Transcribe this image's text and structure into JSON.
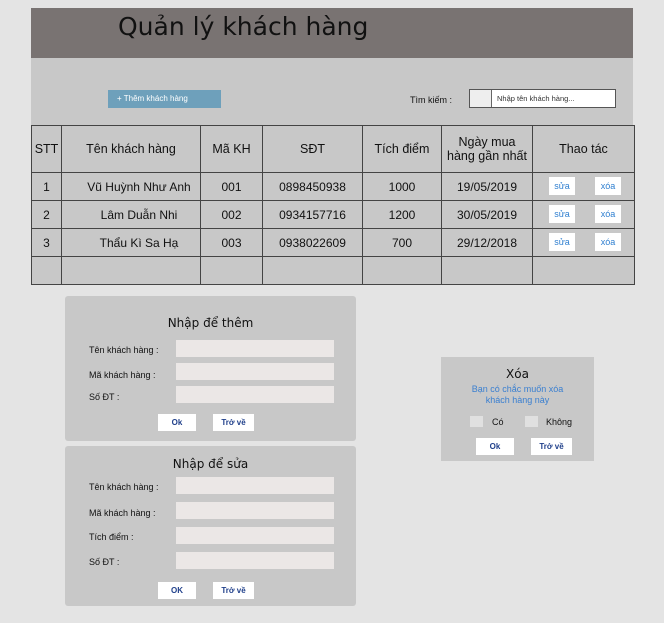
{
  "header": {
    "title": "Quản lý khách hàng"
  },
  "toolbar": {
    "add_label": "+ Thêm khách hàng",
    "search_label": "Tìm kiếm :",
    "search_placeholder": "Nhập tên khách hàng..."
  },
  "table": {
    "headers": {
      "stt": "STT",
      "name": "Tên khách hàng",
      "code": "Mã KH",
      "phone": "SĐT",
      "points": "Tích điểm",
      "date_line1": "Ngày mua",
      "date_line2": "hàng gần nhất",
      "actions": "Thao tác"
    },
    "rows": [
      {
        "stt": "1",
        "name": "Vũ Huỳnh Như Anh",
        "code": "001",
        "phone": "0898450938",
        "points": "1000",
        "date": "19/05/2019",
        "edit": "sửa",
        "delete": "xóa"
      },
      {
        "stt": "2",
        "name": "Lâm Duẫn Nhi",
        "code": "002",
        "phone": "0934157716",
        "points": "1200",
        "date": "30/05/2019",
        "edit": "sửa",
        "delete": "xóa"
      },
      {
        "stt": "3",
        "name": "Thẩu Kì Sa Hạ",
        "code": "003",
        "phone": "0938022609",
        "points": "700",
        "date": "29/12/2018",
        "edit": "sửa",
        "delete": "xóa"
      }
    ]
  },
  "add_form": {
    "title": "Nhập để thêm",
    "name_label": "Tên khách hàng :",
    "code_label": "Mã khách hàng :",
    "phone_label": "Số ĐT :",
    "ok_label": "Ok",
    "back_label": "Trở về"
  },
  "edit_form": {
    "title": "Nhập để sửa",
    "name_label": "Tên khách hàng :",
    "code_label": "Mã khách hàng :",
    "points_label": "Tích điểm :",
    "phone_label": "Số ĐT :",
    "ok_label": "OK",
    "back_label": "Trở về"
  },
  "delete_dialog": {
    "title": "Xóa",
    "question_line1": "Bạn có chắc muốn xóa",
    "question_line2": "khách hàng này",
    "yes_label": "Có",
    "no_label": "Không",
    "ok_label": "Ok",
    "back_label": "Trở về"
  },
  "colors": {
    "header_bg": "#797372",
    "panel_bg": "#c8c8c8",
    "add_button": "#6ea0bb",
    "link_blue": "#2f7fd0"
  }
}
